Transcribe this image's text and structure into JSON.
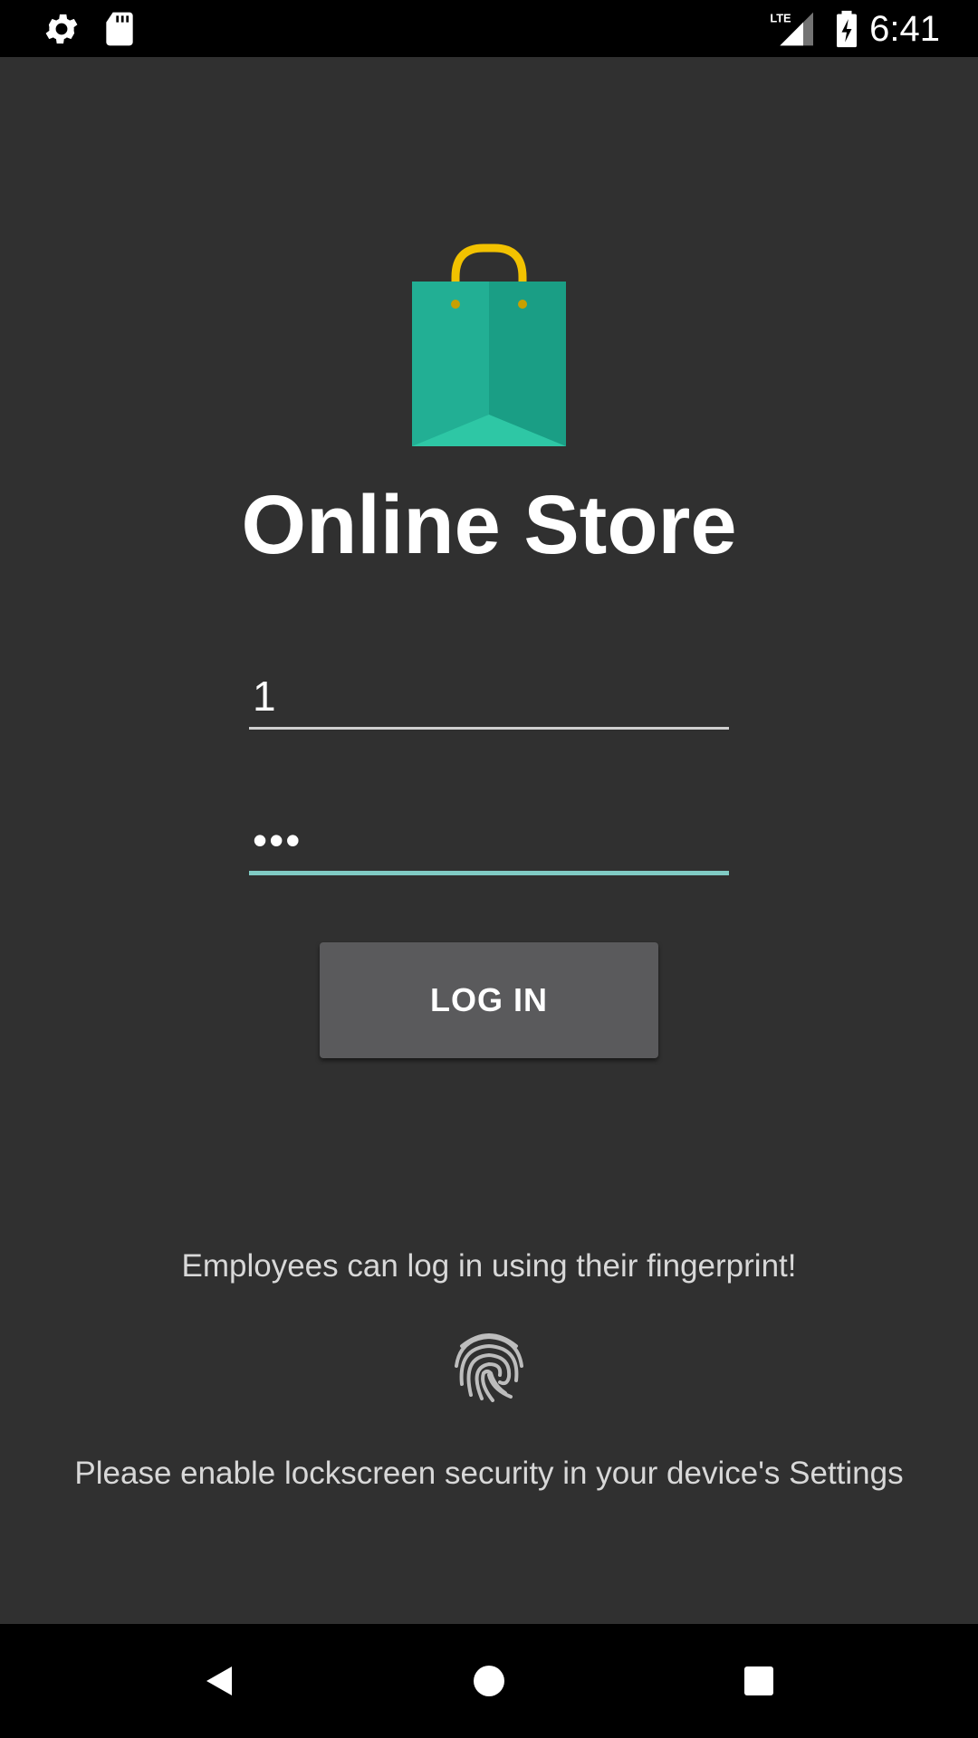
{
  "status_bar": {
    "time": "6:41",
    "network": "LTE",
    "icons": [
      "settings-icon",
      "sd-card-icon",
      "lte-signal-icon",
      "battery-charging-icon"
    ]
  },
  "app": {
    "title": "Online Store",
    "logo": "shopping-bag-icon"
  },
  "login": {
    "username_value": "1",
    "password_value": "•••",
    "button_label": "LOG IN"
  },
  "fingerprint": {
    "message": "Employees can log in using their fingerprint!",
    "icon": "fingerprint-icon",
    "lockscreen_message": "Please enable lockscreen security in your device's Settings"
  },
  "nav_bar": {
    "icons": [
      "back-icon",
      "home-icon",
      "recents-icon"
    ]
  },
  "colors": {
    "background": "#303030",
    "accent": "#80cbc4",
    "bag": "#20a98f",
    "bag_handle": "#f2c200",
    "button": "#5a5a5c"
  }
}
